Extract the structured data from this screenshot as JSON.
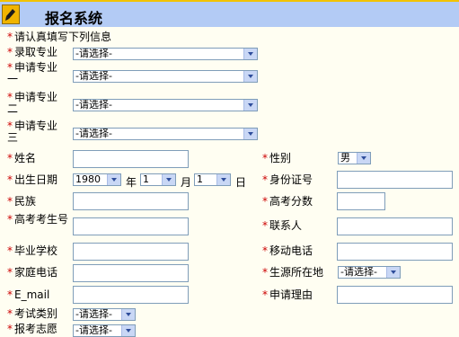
{
  "header": {
    "title": "报名系统"
  },
  "notice": "请认真填写下列信息",
  "star": "*",
  "majors": [
    {
      "label": "录取专业",
      "value": "-请选择-"
    },
    {
      "label": "申请专业一",
      "value": "-请选择-"
    },
    {
      "label": "申请专业二",
      "value": "-请选择-"
    },
    {
      "label": "申请专业三",
      "value": "-请选择-"
    }
  ],
  "fields": {
    "name": "姓名",
    "gender": "性别",
    "gender_value": "男",
    "birth": "出生日期",
    "birth_year": "1980",
    "year_unit": "年",
    "birth_month": "1",
    "month_unit": "月",
    "birth_day": "1",
    "day_unit": "日",
    "id_card": "身份证号",
    "ethnicity": "民族",
    "exam_score": "高考分数",
    "exam_no": "高考考生号",
    "contact": "联系人",
    "school": "毕业学校",
    "mobile": "移动电话",
    "home_phone": "家庭电话",
    "origin": "生源所在地",
    "origin_value": "-请选择-",
    "email": "E_mail",
    "reason": "申请理由",
    "exam_type": "考试类别",
    "exam_type_value": "-请选择-",
    "exam_wish": "报考志愿",
    "exam_wish_value": "-请选择-"
  }
}
